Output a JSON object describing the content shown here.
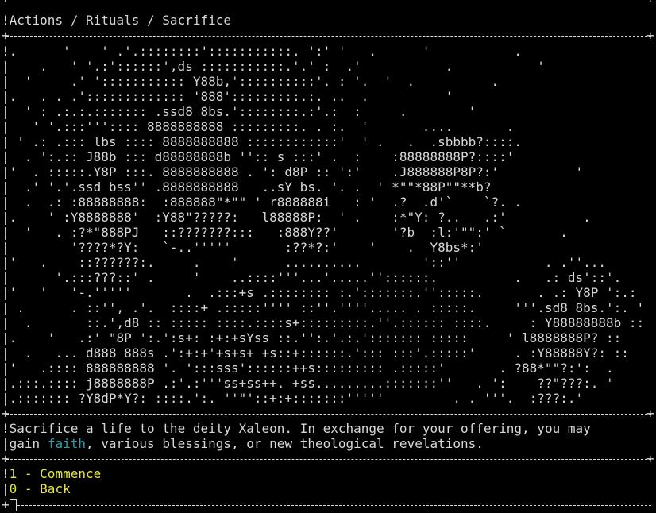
{
  "breadcrumb": "Actions / Rituals / Sacrifice",
  "art": [
    ".      '    ' .'.::::::::':::::::::::. ':' '   .      '           .",
    "    .   ' '.:'::::::',ds :::::::::::.'.' :  .'           .           '",
    "  '     .' '::::::::::: Y88b,'::::::::::'. : '.  '  .          .",
    ".   . . .'::::::::::::: '888':::::::::.:. ..  .          '",
    "  ' : .:.:.::::::: .ssd8 8bs.'::::::::.:'.:  :     .        '",
    "   ' '.:::''':::: 8888888888 :::::::::. . :.  '       ....       .",
    " ' .: .::: lbs :::: 8888888888 ::::::::::::'  ' .   .  .sbbbb?::::.",
    "  . ':.:: J88b ::: d88888888b '':: s :::' .  :    :88888888P?::::'",
    "'  . :::::.Y8P :::. 8888888888 . ': d8P :: ':'    .J888888P8P?:'          '",
    "  .' '.'.ssd bss'' .8888888888   ..sY bs. '. .  ' *\"\"*88P\"\"**b?",
    "  .  .: :88888888:  :888888\"*\"\" ' r888888i   : '  .?  .d'`    `?. .",
    ".    ' :Y8888888'  :Y88\"?????:   l88888P:  ' .    :*\"Y: ?..   .:'          .",
    "  '   . :?*\"888PJ   ::???????:::   :888Y??'       '?b  :l:'\"\":' `       .",
    "        '????*?Y:   `-..'''''       :??*?:'    '    .  Y8bs*:'",
    "'   .    ::??????:.     .    '      ..........        '::''           . .''...",
    "      '.:::???::' .     '    ..::::'''...'.....''::::::.          .   .: ds'::'.",
    "'   '   '-.'''''       .  .:::+s .:::::::: :.':::::::.'':::::.       . .: Y8P ':.:",
    " .      . ::'', .'.  ::::+ .:::::'''' ::''.''''..... . :::::.     '''.sd8 8bs.':. '",
    "  .       ::.',d8 :: ::::: ::::.::::s+:::::::::.''.:::::: ::::.     : Y88888888b ::",
    ".    '   .:' \"8P ':.':s+: :+:+sYss ::.'':.'.:.'::::::: :::::     ' l8888888P? ::",
    "  .   ... d888 888s .':+:+'+s+s+ +s::+::::::.'::: :::'.:::::'     . :Y88888Y?: ::",
    "'   .:::: 888888888 '. ':::sss'::::::++s::::::::: .:::::'       . ?88*\"\"?:':  .",
    ".:::.:::: j8888888P .:'.:'''ss+ss++. +ss.........:::::::''   . ':    ??\"???:. '",
    ".::::::: ?Y8dP*Y?: ::::.':. ''\"'::+:+:::::::'''''         . . '''.  :???:.'"
  ],
  "description": {
    "line1": "Sacrifice a life to the deity Xaleon. In exchange for your offering, you may",
    "line2_prefix": "gain ",
    "faith_word": "faith",
    "line2_suffix": ", various blessings, or new theological revelations."
  },
  "menu": {
    "items": [
      {
        "label": "1 - Commence"
      },
      {
        "label": "0 - Back"
      }
    ]
  },
  "colors": {
    "text": "#d8d8d8",
    "faith": "#2aa1b3",
    "menu": "#e8e83a",
    "background": "#000000"
  }
}
